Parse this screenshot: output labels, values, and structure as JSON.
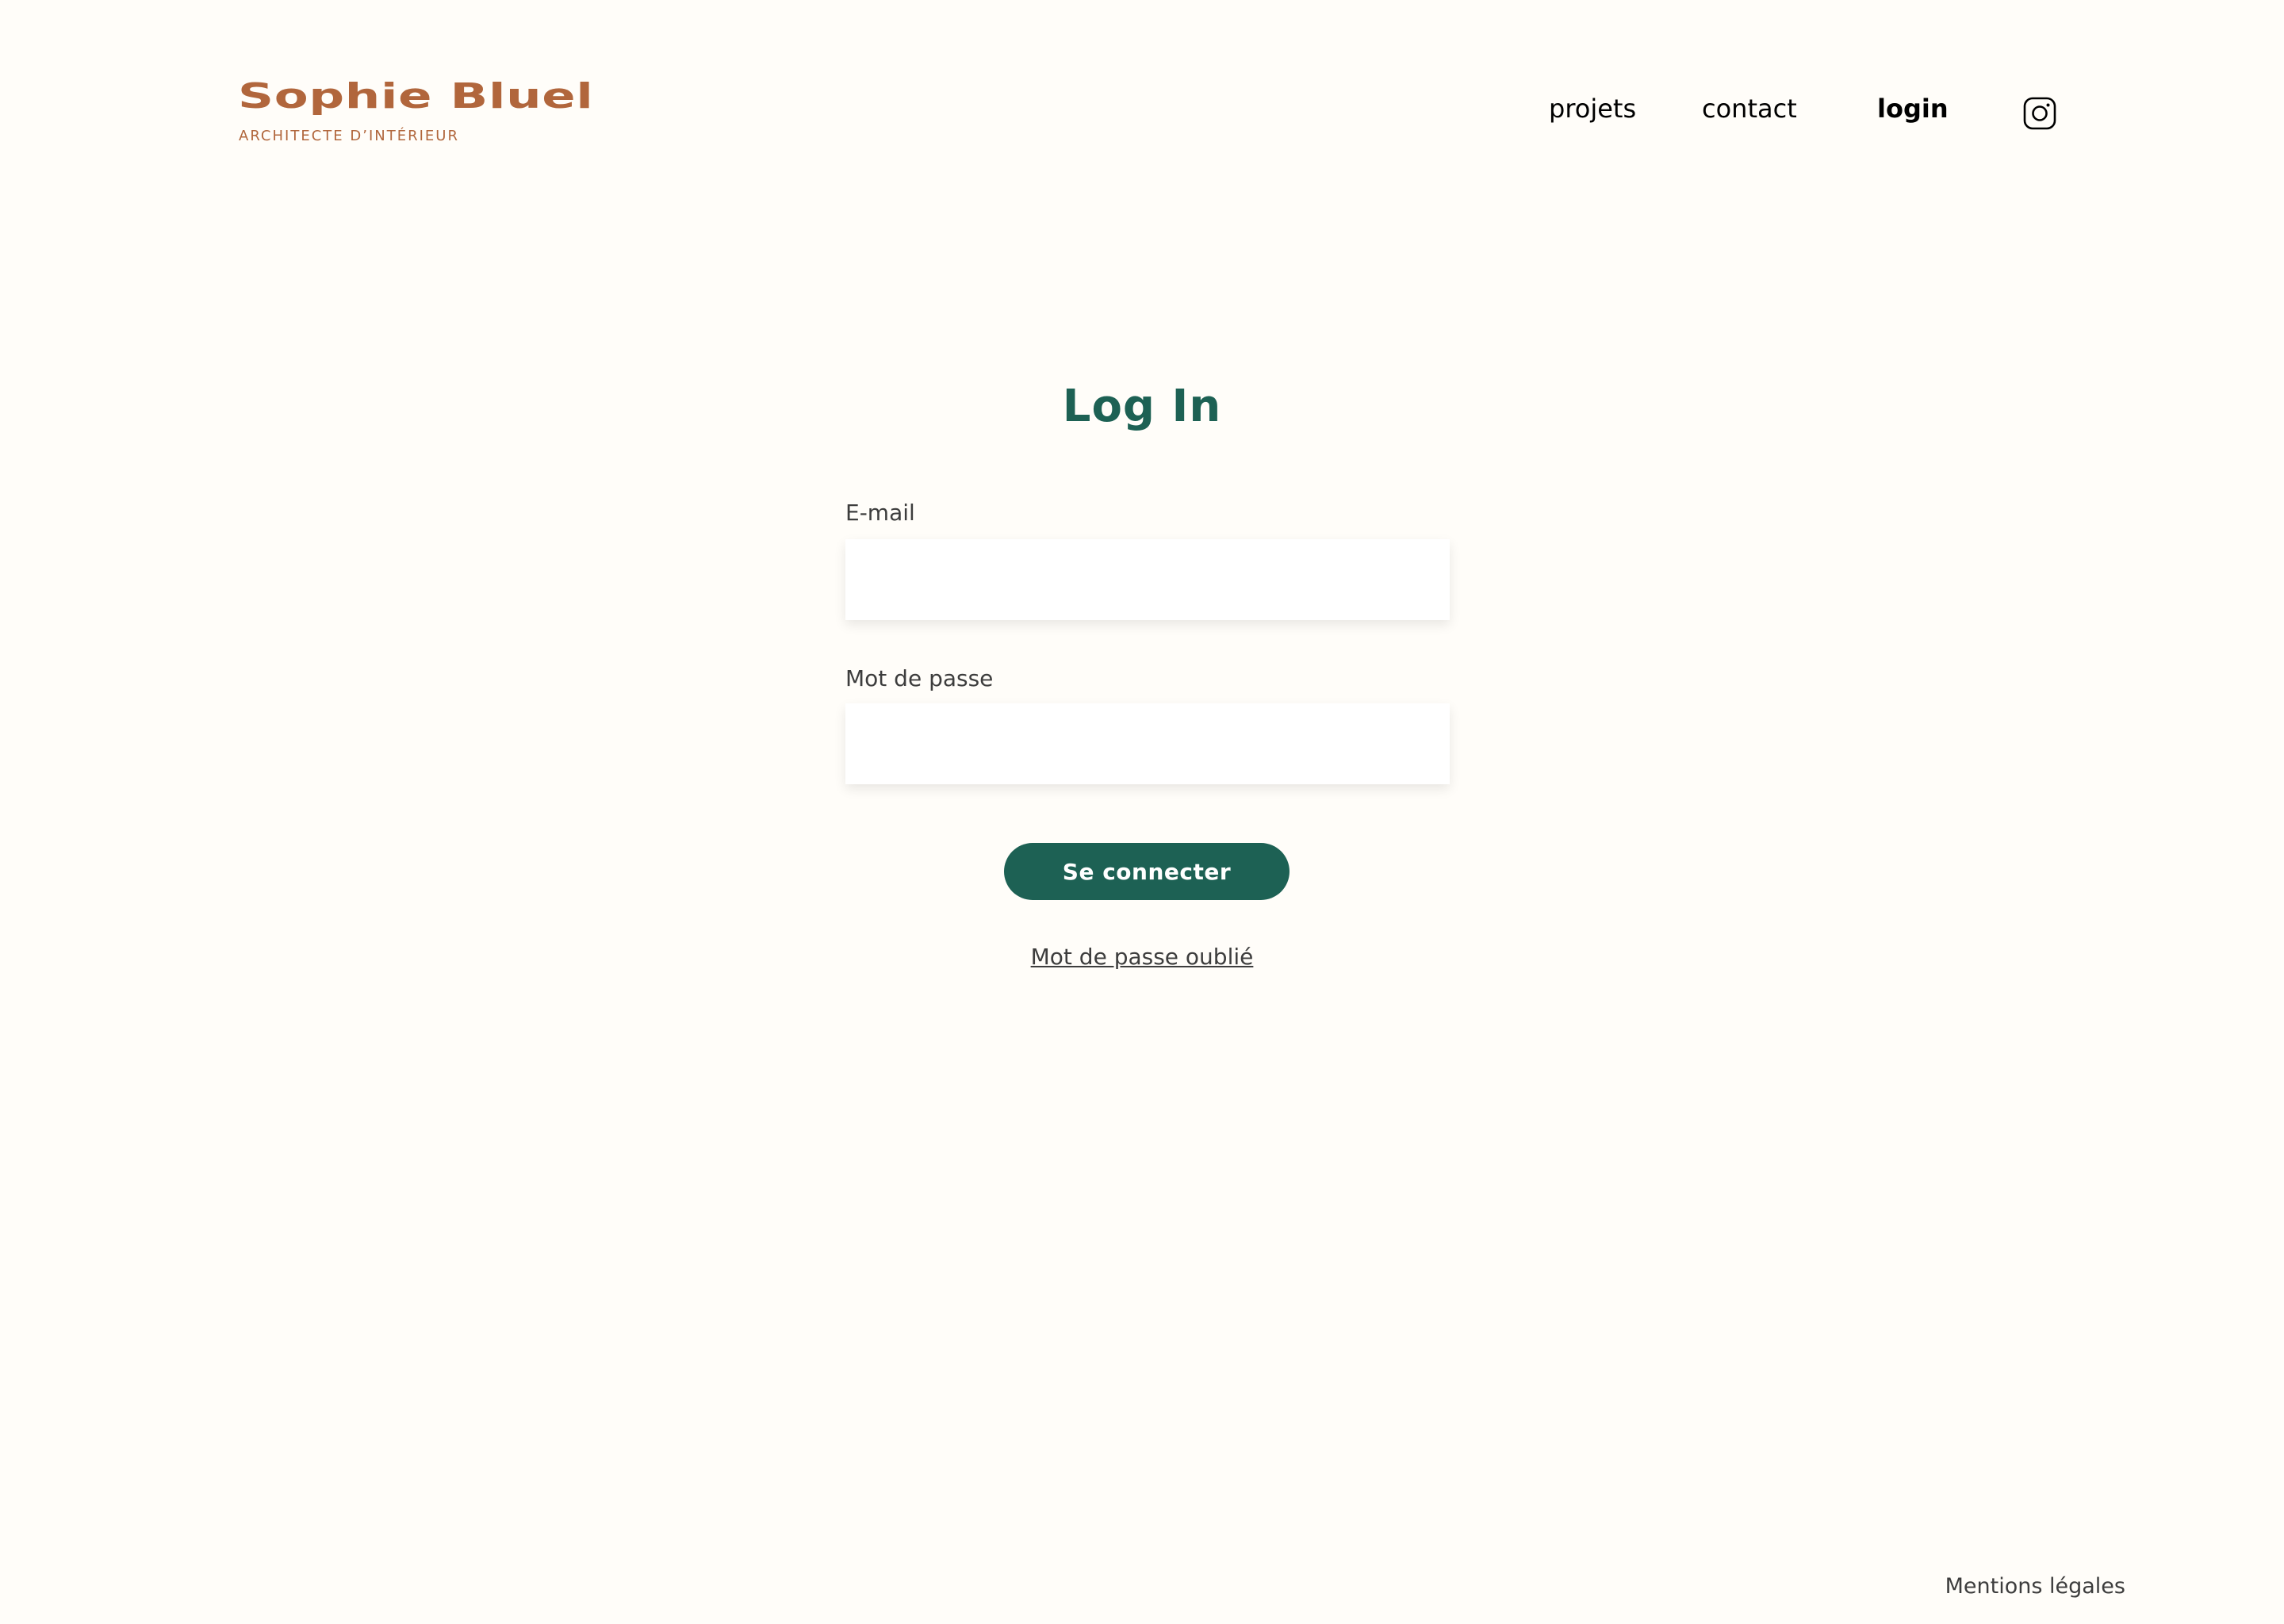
{
  "header": {
    "brand_name": "Sophie Bluel",
    "brand_subtitle": "ARCHITECTE D’INTÉRIEUR",
    "nav": {
      "projets": "projets",
      "contact": "contact",
      "login": "login"
    },
    "instagram_icon": "instagram-icon"
  },
  "main": {
    "title": "Log In",
    "email_label": "E-mail",
    "email_value": "",
    "password_label": "Mot de passe",
    "password_value": "",
    "submit_label": "Se connecter",
    "forgot_label": "Mot de passe oublié"
  },
  "footer": {
    "legal_label": "Mentions légales"
  },
  "colors": {
    "background": "#FFFDF9",
    "brand": "#B1663C",
    "accent": "#1D6154",
    "text": "#3D3D3D"
  }
}
